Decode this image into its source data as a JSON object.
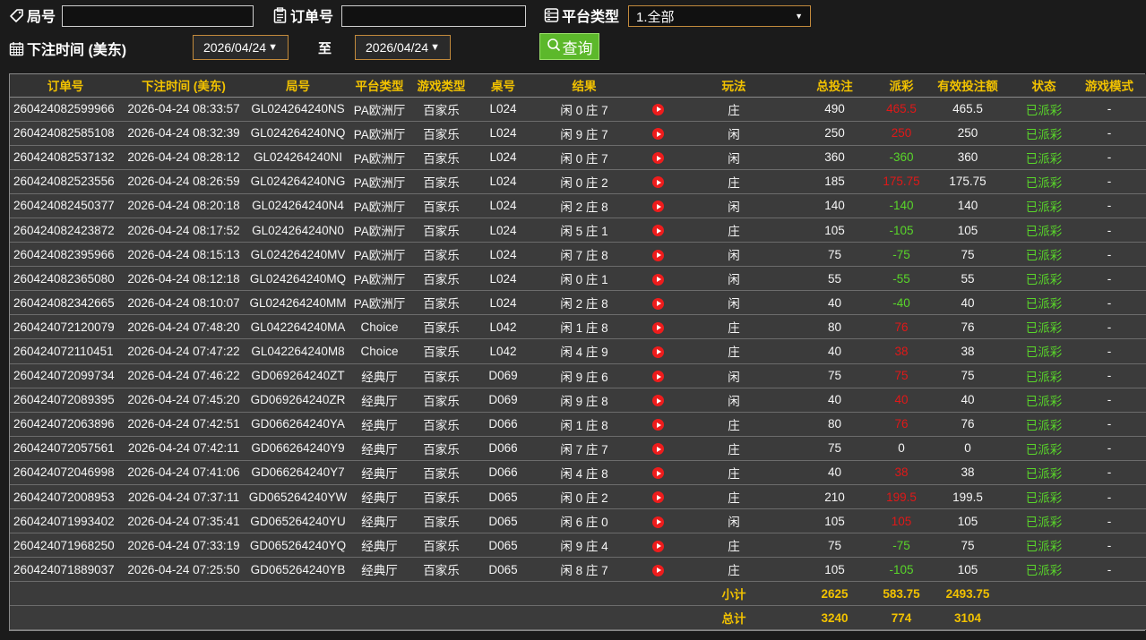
{
  "filters": {
    "round_label": "局号",
    "round_value": "",
    "order_label": "订单号",
    "order_value": "",
    "platform_label": "平台类型",
    "platform_value": "1.全部",
    "bet_time_label": "下注时间 (美东)",
    "date_from": "2026/04/24",
    "to_label": "至",
    "date_to": "2026/04/24",
    "query_label": "查询"
  },
  "table": {
    "headers": [
      "订单号",
      "下注时间 (美东)",
      "局号",
      "平台类型",
      "游戏类型",
      "桌号",
      "结果",
      "",
      "玩法",
      "总投注",
      "派彩",
      "有效投注额",
      "状态",
      "游戏模式"
    ],
    "rows": [
      {
        "order": "260424082599966",
        "time": "2026-04-24 08:33:57",
        "round": "GL024264240NS",
        "platform": "PA欧洲厅",
        "game": "百家乐",
        "table": "L024",
        "result": "闲 0 庄 7",
        "play": "庄",
        "bet": "490",
        "payout": "465.5",
        "payout_color": "red",
        "valid": "465.5",
        "status": "已派彩",
        "mode": "-"
      },
      {
        "order": "260424082585108",
        "time": "2026-04-24 08:32:39",
        "round": "GL024264240NQ",
        "platform": "PA欧洲厅",
        "game": "百家乐",
        "table": "L024",
        "result": "闲 9 庄 7",
        "play": "闲",
        "bet": "250",
        "payout": "250",
        "payout_color": "red",
        "valid": "250",
        "status": "已派彩",
        "mode": "-"
      },
      {
        "order": "260424082537132",
        "time": "2026-04-24 08:28:12",
        "round": "GL024264240NI",
        "platform": "PA欧洲厅",
        "game": "百家乐",
        "table": "L024",
        "result": "闲 0 庄 7",
        "play": "闲",
        "bet": "360",
        "payout": "-360",
        "payout_color": "green",
        "valid": "360",
        "status": "已派彩",
        "mode": "-"
      },
      {
        "order": "260424082523556",
        "time": "2026-04-24 08:26:59",
        "round": "GL024264240NG",
        "platform": "PA欧洲厅",
        "game": "百家乐",
        "table": "L024",
        "result": "闲 0 庄 2",
        "play": "庄",
        "bet": "185",
        "payout": "175.75",
        "payout_color": "red",
        "valid": "175.75",
        "status": "已派彩",
        "mode": "-"
      },
      {
        "order": "260424082450377",
        "time": "2026-04-24 08:20:18",
        "round": "GL024264240N4",
        "platform": "PA欧洲厅",
        "game": "百家乐",
        "table": "L024",
        "result": "闲 2 庄 8",
        "play": "闲",
        "bet": "140",
        "payout": "-140",
        "payout_color": "green",
        "valid": "140",
        "status": "已派彩",
        "mode": "-"
      },
      {
        "order": "260424082423872",
        "time": "2026-04-24 08:17:52",
        "round": "GL024264240N0",
        "platform": "PA欧洲厅",
        "game": "百家乐",
        "table": "L024",
        "result": "闲 5 庄 1",
        "play": "庄",
        "bet": "105",
        "payout": "-105",
        "payout_color": "green",
        "valid": "105",
        "status": "已派彩",
        "mode": "-"
      },
      {
        "order": "260424082395966",
        "time": "2026-04-24 08:15:13",
        "round": "GL024264240MV",
        "platform": "PA欧洲厅",
        "game": "百家乐",
        "table": "L024",
        "result": "闲 7 庄 8",
        "play": "闲",
        "bet": "75",
        "payout": "-75",
        "payout_color": "green",
        "valid": "75",
        "status": "已派彩",
        "mode": "-"
      },
      {
        "order": "260424082365080",
        "time": "2026-04-24 08:12:18",
        "round": "GL024264240MQ",
        "platform": "PA欧洲厅",
        "game": "百家乐",
        "table": "L024",
        "result": "闲 0 庄 1",
        "play": "闲",
        "bet": "55",
        "payout": "-55",
        "payout_color": "green",
        "valid": "55",
        "status": "已派彩",
        "mode": "-"
      },
      {
        "order": "260424082342665",
        "time": "2026-04-24 08:10:07",
        "round": "GL024264240MM",
        "platform": "PA欧洲厅",
        "game": "百家乐",
        "table": "L024",
        "result": "闲 2 庄 8",
        "play": "闲",
        "bet": "40",
        "payout": "-40",
        "payout_color": "green",
        "valid": "40",
        "status": "已派彩",
        "mode": "-"
      },
      {
        "order": "260424072120079",
        "time": "2026-04-24 07:48:20",
        "round": "GL042264240MA",
        "platform": "Choice",
        "game": "百家乐",
        "table": "L042",
        "result": "闲 1 庄 8",
        "play": "庄",
        "bet": "80",
        "payout": "76",
        "payout_color": "red",
        "valid": "76",
        "status": "已派彩",
        "mode": "-"
      },
      {
        "order": "260424072110451",
        "time": "2026-04-24 07:47:22",
        "round": "GL042264240M8",
        "platform": "Choice",
        "game": "百家乐",
        "table": "L042",
        "result": "闲 4 庄 9",
        "play": "庄",
        "bet": "40",
        "payout": "38",
        "payout_color": "red",
        "valid": "38",
        "status": "已派彩",
        "mode": "-"
      },
      {
        "order": "260424072099734",
        "time": "2026-04-24 07:46:22",
        "round": "GD069264240ZT",
        "platform": "经典厅",
        "game": "百家乐",
        "table": "D069",
        "result": "闲 9 庄 6",
        "play": "闲",
        "bet": "75",
        "payout": "75",
        "payout_color": "red",
        "valid": "75",
        "status": "已派彩",
        "mode": "-"
      },
      {
        "order": "260424072089395",
        "time": "2026-04-24 07:45:20",
        "round": "GD069264240ZR",
        "platform": "经典厅",
        "game": "百家乐",
        "table": "D069",
        "result": "闲 9 庄 8",
        "play": "闲",
        "bet": "40",
        "payout": "40",
        "payout_color": "red",
        "valid": "40",
        "status": "已派彩",
        "mode": "-"
      },
      {
        "order": "260424072063896",
        "time": "2026-04-24 07:42:51",
        "round": "GD066264240YA",
        "platform": "经典厅",
        "game": "百家乐",
        "table": "D066",
        "result": "闲 1 庄 8",
        "play": "庄",
        "bet": "80",
        "payout": "76",
        "payout_color": "red",
        "valid": "76",
        "status": "已派彩",
        "mode": "-"
      },
      {
        "order": "260424072057561",
        "time": "2026-04-24 07:42:11",
        "round": "GD066264240Y9",
        "platform": "经典厅",
        "game": "百家乐",
        "table": "D066",
        "result": "闲 7 庄 7",
        "play": "庄",
        "bet": "75",
        "payout": "0",
        "payout_color": "white",
        "valid": "0",
        "status": "已派彩",
        "mode": "-"
      },
      {
        "order": "260424072046998",
        "time": "2026-04-24 07:41:06",
        "round": "GD066264240Y7",
        "platform": "经典厅",
        "game": "百家乐",
        "table": "D066",
        "result": "闲 4 庄 8",
        "play": "庄",
        "bet": "40",
        "payout": "38",
        "payout_color": "red",
        "valid": "38",
        "status": "已派彩",
        "mode": "-"
      },
      {
        "order": "260424072008953",
        "time": "2026-04-24 07:37:11",
        "round": "GD065264240YW",
        "platform": "经典厅",
        "game": "百家乐",
        "table": "D065",
        "result": "闲 0 庄 2",
        "play": "庄",
        "bet": "210",
        "payout": "199.5",
        "payout_color": "red",
        "valid": "199.5",
        "status": "已派彩",
        "mode": "-"
      },
      {
        "order": "260424071993402",
        "time": "2026-04-24 07:35:41",
        "round": "GD065264240YU",
        "platform": "经典厅",
        "game": "百家乐",
        "table": "D065",
        "result": "闲 6 庄 0",
        "play": "闲",
        "bet": "105",
        "payout": "105",
        "payout_color": "red",
        "valid": "105",
        "status": "已派彩",
        "mode": "-"
      },
      {
        "order": "260424071968250",
        "time": "2026-04-24 07:33:19",
        "round": "GD065264240YQ",
        "platform": "经典厅",
        "game": "百家乐",
        "table": "D065",
        "result": "闲 9 庄 4",
        "play": "庄",
        "bet": "75",
        "payout": "-75",
        "payout_color": "green",
        "valid": "75",
        "status": "已派彩",
        "mode": "-"
      },
      {
        "order": "260424071889037",
        "time": "2026-04-24 07:25:50",
        "round": "GD065264240YB",
        "platform": "经典厅",
        "game": "百家乐",
        "table": "D065",
        "result": "闲 8 庄 7",
        "play": "庄",
        "bet": "105",
        "payout": "-105",
        "payout_color": "green",
        "valid": "105",
        "status": "已派彩",
        "mode": "-"
      }
    ],
    "subtotal": {
      "label": "小计",
      "bet": "2625",
      "payout": "583.75",
      "valid": "2493.75"
    },
    "total": {
      "label": "总计",
      "bet": "3240",
      "payout": "774",
      "valid": "3104"
    }
  },
  "icons": {
    "round": "tag-icon",
    "order": "clipboard-icon",
    "platform": "server-icon",
    "date": "calendar-icon",
    "query": "search-icon",
    "replay": "play-icon"
  },
  "colors": {
    "header_text": "#f2c200",
    "status_green": "#59d62a",
    "payout_red": "#e01818",
    "payout_green": "#59d62a",
    "query_button": "#5cb82b",
    "select_border": "#c28a3c"
  }
}
